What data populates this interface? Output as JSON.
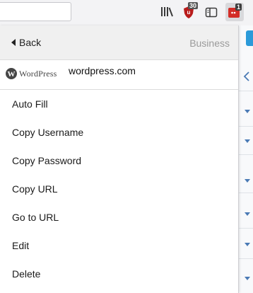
{
  "toolbar": {
    "library_icon": "library-icon",
    "ublock_icon": "ublock-icon",
    "ublock_badge": "30",
    "sidebar_icon": "sidebar-icon",
    "lastpass_icon": "lastpass-icon",
    "lastpass_badge": "1"
  },
  "panel": {
    "back_label": "Back",
    "category": "Business",
    "site": {
      "logo_letter": "W",
      "logo_text": "WordPress",
      "name": "wordpress.com"
    },
    "menu_items": [
      {
        "label": "Auto Fill"
      },
      {
        "label": "Copy Username"
      },
      {
        "label": "Copy Password"
      },
      {
        "label": "Copy URL"
      },
      {
        "label": "Go to URL"
      },
      {
        "label": "Edit"
      },
      {
        "label": "Delete"
      }
    ]
  },
  "colors": {
    "accent_blue": "#2b9ad9",
    "ublock_red": "#b81c1c",
    "lastpass_red": "#d32d27"
  }
}
